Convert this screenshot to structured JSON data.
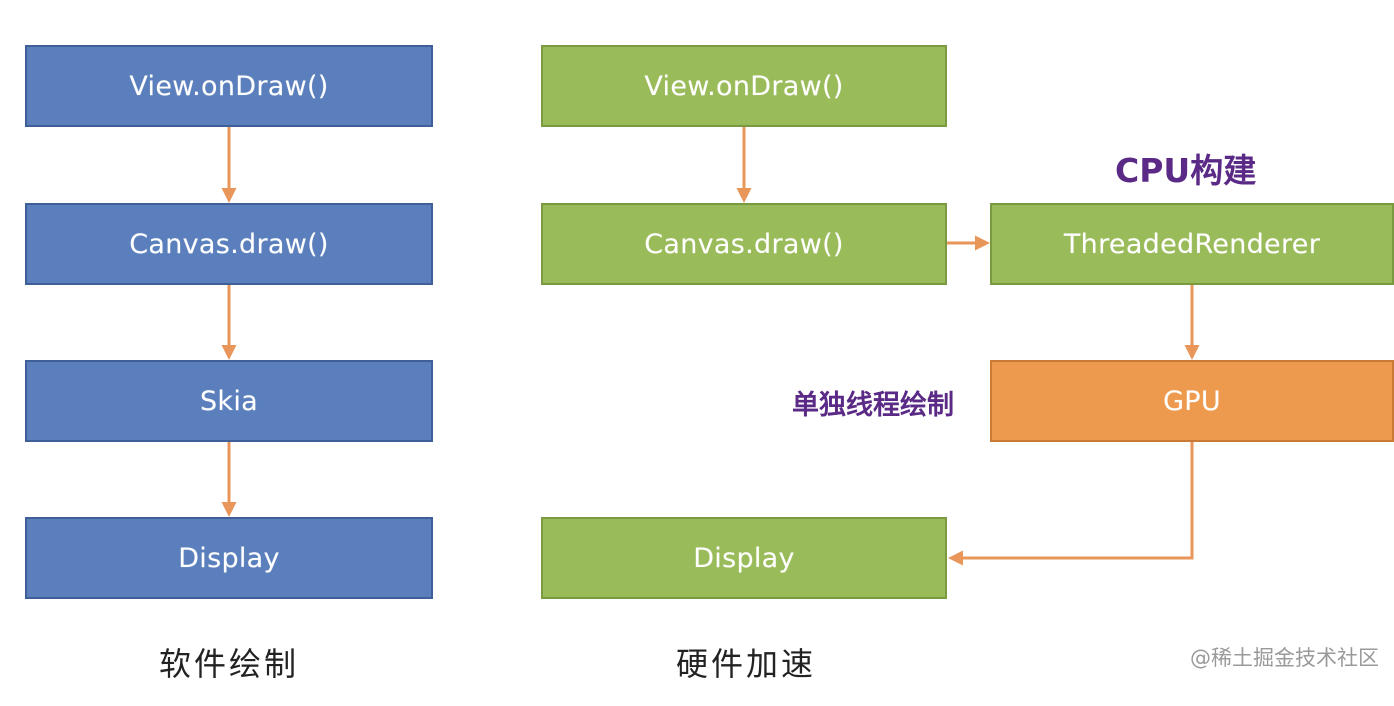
{
  "software": {
    "steps": [
      "View.onDraw()",
      "Canvas.draw()",
      "Skia",
      "Display"
    ],
    "caption": "软件绘制"
  },
  "hardware": {
    "main_steps": [
      "View.onDraw()",
      "Canvas.draw()",
      "Display"
    ],
    "side_steps": [
      "ThreadedRenderer",
      "GPU"
    ],
    "cpu_note": "CPU构建",
    "thread_note": "单独线程绘制",
    "caption": "硬件加速"
  },
  "watermark": "@稀土掘金技术社区",
  "colors": {
    "software_box": "#5a7fbc",
    "hardware_box": "#99bb59",
    "gpu_box": "#ee9a4e",
    "arrow": "#e8965a",
    "note_text": "#5a2a86"
  }
}
